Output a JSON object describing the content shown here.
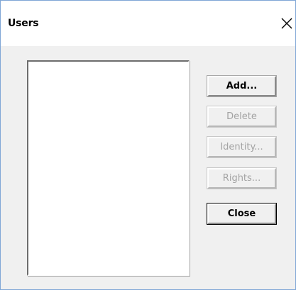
{
  "window": {
    "title": "Users",
    "close_icon": "close-icon"
  },
  "buttons": {
    "add": "Add...",
    "delete": "Delete",
    "identity": "Identity...",
    "rights": "Rights...",
    "close": "Close"
  },
  "users_list": {
    "items": []
  }
}
